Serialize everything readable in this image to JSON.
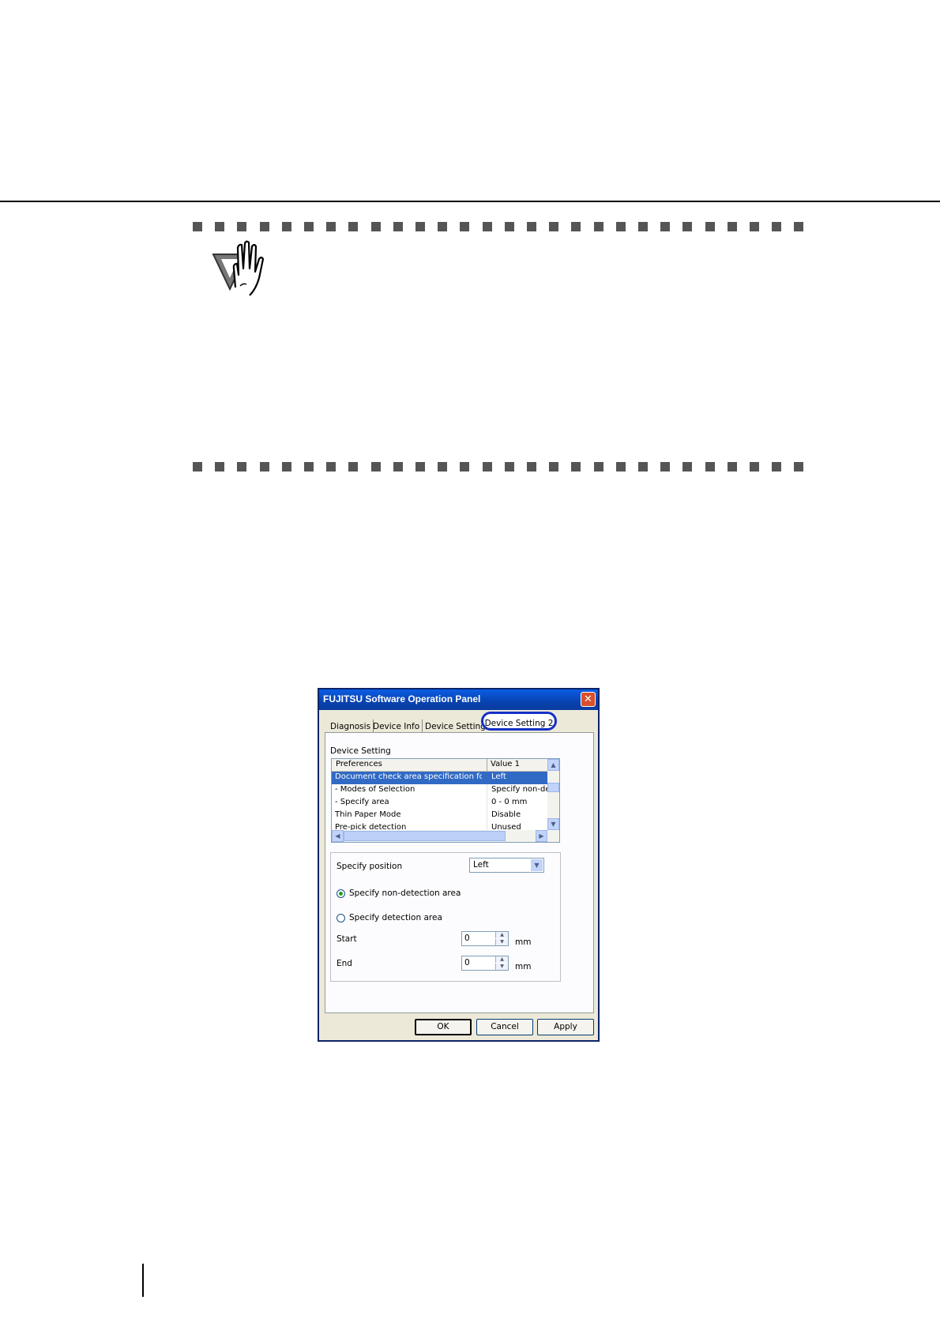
{
  "dialog": {
    "title": "FUJITSU Software Operation Panel",
    "close_glyph": "✕",
    "tabs": [
      "Diagnosis",
      "Device Info",
      "Device Setting",
      "Device Setting 2"
    ],
    "section_label": "Device Setting",
    "list": {
      "headers": [
        "Preferences",
        "Value 1"
      ],
      "rows": [
        {
          "pref": "Document check area specification for ...",
          "value": "Left"
        },
        {
          "pref": " - Modes of Selection",
          "value": "Specify non-det"
        },
        {
          "pref": " - Specify area",
          "value": "0 - 0 mm"
        },
        {
          "pref": "Thin Paper Mode",
          "value": "Disable"
        },
        {
          "pref": "Pre-pick detection",
          "value": "Unused"
        }
      ],
      "selected_row": 0
    },
    "position_label": "Specify position",
    "position_value": "Left",
    "radio_non_detection": "Specify non-detection area",
    "radio_detection": "Specify detection area",
    "start_label": "Start",
    "start_value": "0",
    "end_label": "End",
    "end_value": "0",
    "unit": "mm",
    "buttons": {
      "ok": "OK",
      "cancel": "Cancel",
      "apply": "Apply"
    }
  },
  "colors": {
    "title_bar": "#0a5de4",
    "selection": "#316ac5",
    "highlight_ring": "#1530c8"
  }
}
